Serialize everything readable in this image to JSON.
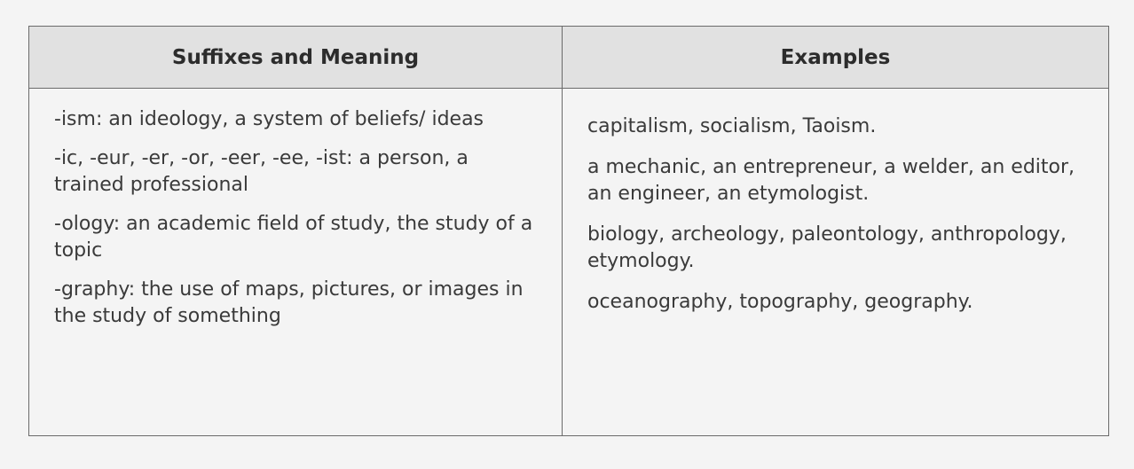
{
  "table": {
    "headers": [
      "Suffixes and Meaning",
      "Examples"
    ],
    "suffixes": [
      "-ism: an ideology, a system of beliefs/ ideas",
      "-ic, -eur, -er, -or, -eer, -ee, -ist: a person, a trained professional",
      "-ology: an academic field of study, the study of a topic",
      "-graphy: the use of maps, pictures, or images in the study of something"
    ],
    "examples": [
      "capitalism, socialism, Taoism.",
      "a mechanic, an entrepreneur, a welder, an editor, an engineer, an etymologist.",
      "biology, archeology, paleontology, anthropology, etymology.",
      "oceanography, topography, geography."
    ]
  }
}
